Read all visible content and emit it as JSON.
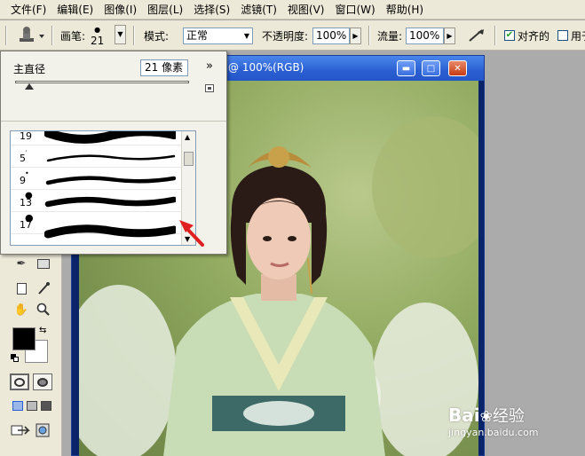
{
  "menu": [
    "文件(F)",
    "编辑(E)",
    "图像(I)",
    "图层(L)",
    "选择(S)",
    "滤镜(T)",
    "视图(V)",
    "窗口(W)",
    "帮助(H)"
  ],
  "options": {
    "brush_label": "画笔:",
    "brush_size": "21",
    "mode_label": "模式:",
    "mode_value": "正常",
    "opacity_label": "不透明度:",
    "opacity_value": "100%",
    "flow_label": "流量:",
    "flow_value": "100%",
    "aligned_label": "对齐的",
    "sample_label": "用于"
  },
  "brush_picker": {
    "diameter_label": "主直径",
    "diameter_value": "21 像素",
    "menu_arrow": "»",
    "slider_level": 0.08,
    "brushes": [
      {
        "size": "19"
      },
      {
        "size": "5"
      },
      {
        "size": "9"
      },
      {
        "size": "13"
      },
      {
        "size": "17"
      }
    ]
  },
  "document": {
    "title": "@ 100%(RGB)"
  },
  "watermark": {
    "brand": "Bai",
    "brand2": "经验",
    "url": "jingyan.baidu.com"
  },
  "colors": {
    "ui_bg": "#ece9d8",
    "title_blue": "#2a5fd2",
    "arrow_red": "#e02020",
    "foreground": "#000000",
    "background": "#ffffff"
  }
}
